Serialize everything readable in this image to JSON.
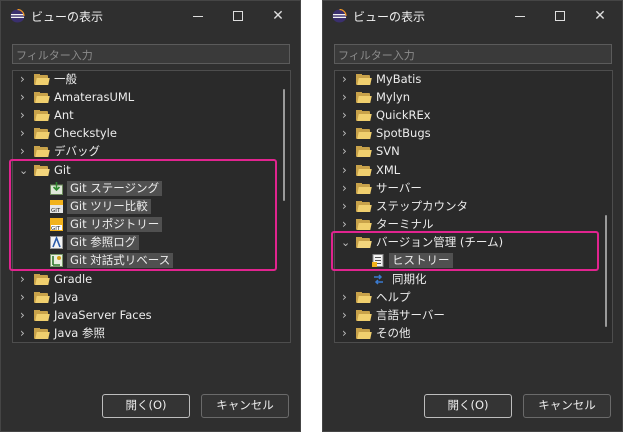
{
  "dialogs": [
    {
      "title": "ビューの表示",
      "window_controls": {
        "minimize": "minimize-icon",
        "maximize": "maximize-icon",
        "close": "✕"
      },
      "filter_placeholder": "フィルター入力",
      "items": [
        "一般",
        "AmaterasUML",
        "Ant",
        "Checkstyle",
        "デバッグ",
        "Git",
        "Git ステージング",
        "Git ツリー比較",
        "Git リポジトリー",
        "Git 参照ログ",
        "Git 対話式リベース",
        "Gradle",
        "Java",
        "JavaServer Faces",
        "Java 参照"
      ],
      "buttons": {
        "open": "開く(O)",
        "cancel": "キャンセル"
      }
    },
    {
      "title": "ビューの表示",
      "window_controls": {
        "minimize": "minimize-icon",
        "maximize": "maximize-icon",
        "close": "✕"
      },
      "filter_placeholder": "フィルター入力",
      "items": [
        "MyBatis",
        "Mylyn",
        "QuickREx",
        "SpotBugs",
        "SVN",
        "XML",
        "サーバー",
        "ステップカウンタ",
        "ターミナル",
        "バージョン管理 (チーム)",
        "ヒストリー",
        "同期化",
        "ヘルプ",
        "言語サーバー",
        "その他"
      ],
      "buttons": {
        "open": "開く(O)",
        "cancel": "キャンセル"
      }
    }
  ],
  "colors": {
    "accent_highlight": "#e1248f",
    "dialog_bg": "#2f2f2f",
    "folder": "#f0cf6e"
  }
}
